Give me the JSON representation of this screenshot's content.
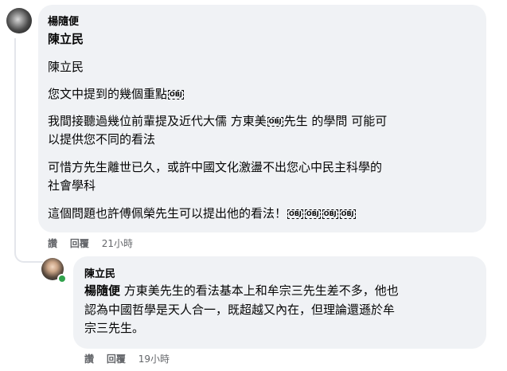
{
  "comment1": {
    "author": "楊隨便",
    "tag": "陳立民",
    "paragraphs": [
      "陳立民",
      "您文中提到的幾個重點",
      "我間接聽過幾位前輩提及近代大儒 方東美",
      "先生 的學問 可能可",
      "以提供您不同的看法",
      "可惜方先生離世已久，或許中國文化激盪不出您心中民主科學的",
      "社會學科",
      "這個問題也許傅佩榮先生可以提出他的看法！"
    ],
    "obj_label": "OBJ",
    "actions": {
      "like": "讚",
      "reply": "回覆",
      "time": "21小時"
    }
  },
  "comment2": {
    "author": "陳立民",
    "tag": "楊隨便",
    "lines": [
      "方東美先生的看法基本上和牟宗三先生差不多，他也",
      "認為中國哲學是天人合一，既超越又內在，但理論還遜於牟",
      "宗三先生。"
    ],
    "actions": {
      "like": "讚",
      "reply": "回覆",
      "time": "19小時"
    }
  }
}
